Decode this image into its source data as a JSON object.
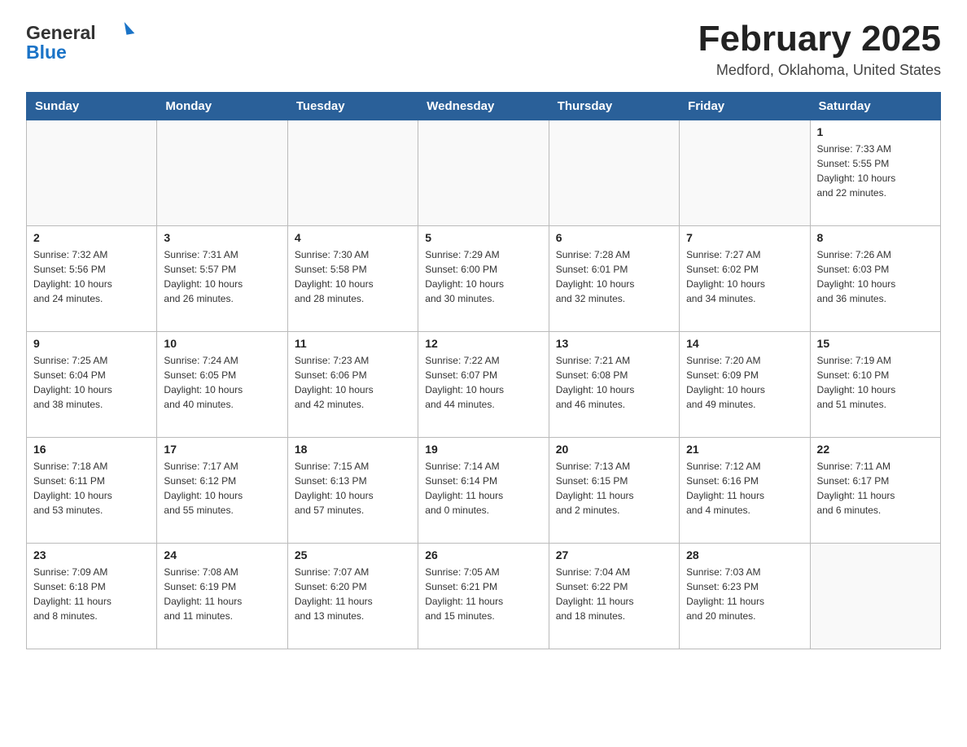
{
  "header": {
    "logo_general": "General",
    "logo_blue": "Blue",
    "title": "February 2025",
    "subtitle": "Medford, Oklahoma, United States"
  },
  "weekdays": [
    "Sunday",
    "Monday",
    "Tuesday",
    "Wednesday",
    "Thursday",
    "Friday",
    "Saturday"
  ],
  "weeks": [
    [
      {
        "day": "",
        "info": ""
      },
      {
        "day": "",
        "info": ""
      },
      {
        "day": "",
        "info": ""
      },
      {
        "day": "",
        "info": ""
      },
      {
        "day": "",
        "info": ""
      },
      {
        "day": "",
        "info": ""
      },
      {
        "day": "1",
        "info": "Sunrise: 7:33 AM\nSunset: 5:55 PM\nDaylight: 10 hours\nand 22 minutes."
      }
    ],
    [
      {
        "day": "2",
        "info": "Sunrise: 7:32 AM\nSunset: 5:56 PM\nDaylight: 10 hours\nand 24 minutes."
      },
      {
        "day": "3",
        "info": "Sunrise: 7:31 AM\nSunset: 5:57 PM\nDaylight: 10 hours\nand 26 minutes."
      },
      {
        "day": "4",
        "info": "Sunrise: 7:30 AM\nSunset: 5:58 PM\nDaylight: 10 hours\nand 28 minutes."
      },
      {
        "day": "5",
        "info": "Sunrise: 7:29 AM\nSunset: 6:00 PM\nDaylight: 10 hours\nand 30 minutes."
      },
      {
        "day": "6",
        "info": "Sunrise: 7:28 AM\nSunset: 6:01 PM\nDaylight: 10 hours\nand 32 minutes."
      },
      {
        "day": "7",
        "info": "Sunrise: 7:27 AM\nSunset: 6:02 PM\nDaylight: 10 hours\nand 34 minutes."
      },
      {
        "day": "8",
        "info": "Sunrise: 7:26 AM\nSunset: 6:03 PM\nDaylight: 10 hours\nand 36 minutes."
      }
    ],
    [
      {
        "day": "9",
        "info": "Sunrise: 7:25 AM\nSunset: 6:04 PM\nDaylight: 10 hours\nand 38 minutes."
      },
      {
        "day": "10",
        "info": "Sunrise: 7:24 AM\nSunset: 6:05 PM\nDaylight: 10 hours\nand 40 minutes."
      },
      {
        "day": "11",
        "info": "Sunrise: 7:23 AM\nSunset: 6:06 PM\nDaylight: 10 hours\nand 42 minutes."
      },
      {
        "day": "12",
        "info": "Sunrise: 7:22 AM\nSunset: 6:07 PM\nDaylight: 10 hours\nand 44 minutes."
      },
      {
        "day": "13",
        "info": "Sunrise: 7:21 AM\nSunset: 6:08 PM\nDaylight: 10 hours\nand 46 minutes."
      },
      {
        "day": "14",
        "info": "Sunrise: 7:20 AM\nSunset: 6:09 PM\nDaylight: 10 hours\nand 49 minutes."
      },
      {
        "day": "15",
        "info": "Sunrise: 7:19 AM\nSunset: 6:10 PM\nDaylight: 10 hours\nand 51 minutes."
      }
    ],
    [
      {
        "day": "16",
        "info": "Sunrise: 7:18 AM\nSunset: 6:11 PM\nDaylight: 10 hours\nand 53 minutes."
      },
      {
        "day": "17",
        "info": "Sunrise: 7:17 AM\nSunset: 6:12 PM\nDaylight: 10 hours\nand 55 minutes."
      },
      {
        "day": "18",
        "info": "Sunrise: 7:15 AM\nSunset: 6:13 PM\nDaylight: 10 hours\nand 57 minutes."
      },
      {
        "day": "19",
        "info": "Sunrise: 7:14 AM\nSunset: 6:14 PM\nDaylight: 11 hours\nand 0 minutes."
      },
      {
        "day": "20",
        "info": "Sunrise: 7:13 AM\nSunset: 6:15 PM\nDaylight: 11 hours\nand 2 minutes."
      },
      {
        "day": "21",
        "info": "Sunrise: 7:12 AM\nSunset: 6:16 PM\nDaylight: 11 hours\nand 4 minutes."
      },
      {
        "day": "22",
        "info": "Sunrise: 7:11 AM\nSunset: 6:17 PM\nDaylight: 11 hours\nand 6 minutes."
      }
    ],
    [
      {
        "day": "23",
        "info": "Sunrise: 7:09 AM\nSunset: 6:18 PM\nDaylight: 11 hours\nand 8 minutes."
      },
      {
        "day": "24",
        "info": "Sunrise: 7:08 AM\nSunset: 6:19 PM\nDaylight: 11 hours\nand 11 minutes."
      },
      {
        "day": "25",
        "info": "Sunrise: 7:07 AM\nSunset: 6:20 PM\nDaylight: 11 hours\nand 13 minutes."
      },
      {
        "day": "26",
        "info": "Sunrise: 7:05 AM\nSunset: 6:21 PM\nDaylight: 11 hours\nand 15 minutes."
      },
      {
        "day": "27",
        "info": "Sunrise: 7:04 AM\nSunset: 6:22 PM\nDaylight: 11 hours\nand 18 minutes."
      },
      {
        "day": "28",
        "info": "Sunrise: 7:03 AM\nSunset: 6:23 PM\nDaylight: 11 hours\nand 20 minutes."
      },
      {
        "day": "",
        "info": ""
      }
    ]
  ]
}
